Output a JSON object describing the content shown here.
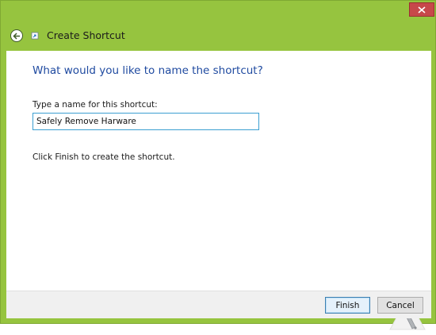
{
  "window": {
    "close_icon": "close-icon",
    "frame_color": "#96c43f",
    "close_color": "#c7484a"
  },
  "header": {
    "back_icon": "back-arrow-icon",
    "app_icon": "shortcut-wizard-icon",
    "title": "Create Shortcut"
  },
  "main": {
    "question": "What would you like to name the shortcut?",
    "field_label": "Type a name for this shortcut:",
    "name_value": "Safely Remove Harware",
    "hint": "Click Finish to create the shortcut.",
    "watermark_icon": "hammer-logo-icon"
  },
  "footer": {
    "finish_label": "Finish",
    "cancel_label": "Cancel"
  },
  "colors": {
    "heading_blue": "#1f4aa0",
    "input_border": "#3c9fd1"
  }
}
